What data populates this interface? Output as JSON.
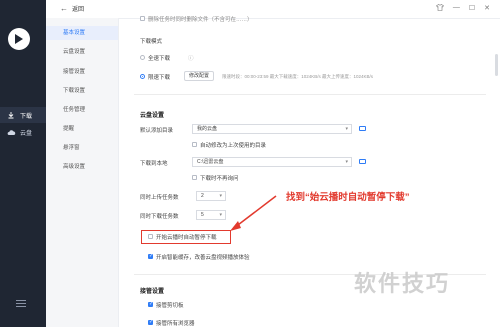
{
  "rail": {
    "items": [
      {
        "label": "下载",
        "icon": "download-icon",
        "active": true
      },
      {
        "label": "云盘",
        "icon": "cloud-icon",
        "active": false
      }
    ]
  },
  "titlebar": {
    "back_label": "返回"
  },
  "nav": {
    "items": [
      "基本设置",
      "云盘设置",
      "接管设置",
      "下载设置",
      "任务管理",
      "提醒",
      "悬浮窗",
      "高级设置"
    ],
    "active_index": 0
  },
  "top": {
    "partial_text": "删除任务时同时删除文件（不含可在……）",
    "download_mode_label": "下载模式",
    "full_speed_label": "全速下载",
    "limited_label": "限速下载",
    "modify_button": "修改配置",
    "limited_desc": "限速时段：00:00-23:59 最大下载速度：1024KB/s 最大上传速度：1024KB/s"
  },
  "cloud": {
    "section_title": "云盘设置",
    "default_dir_label": "默认添加目录",
    "default_dir_value": "我的云盘",
    "auto_change_label": "自动修改为上次使用的目录",
    "local_dir_label": "下载到本地",
    "local_dir_value": "C:\\迅雷云盘",
    "no_ask_label": "下载时不再询问",
    "upload_tasks_label": "同时上传任务数",
    "upload_tasks_value": "2",
    "download_tasks_label": "同时下载任务数",
    "download_tasks_value": "5",
    "auto_pause_label": "开始云播时自动暂停下载",
    "smart_cache_label": "开启智能缓存，改善云盘视频播放体验"
  },
  "takeover": {
    "section_title": "接管设置",
    "clipboard_label": "接管剪切板",
    "all_browsers_label": "接管所有浏览器"
  },
  "annotation": {
    "text": "找到“始云播时自动暂停下载”"
  },
  "watermark": {
    "text": "软件技巧"
  },
  "colors": {
    "accent": "#2f7cf6",
    "annotation": "#e23a2e",
    "rail": "#1f2633"
  }
}
